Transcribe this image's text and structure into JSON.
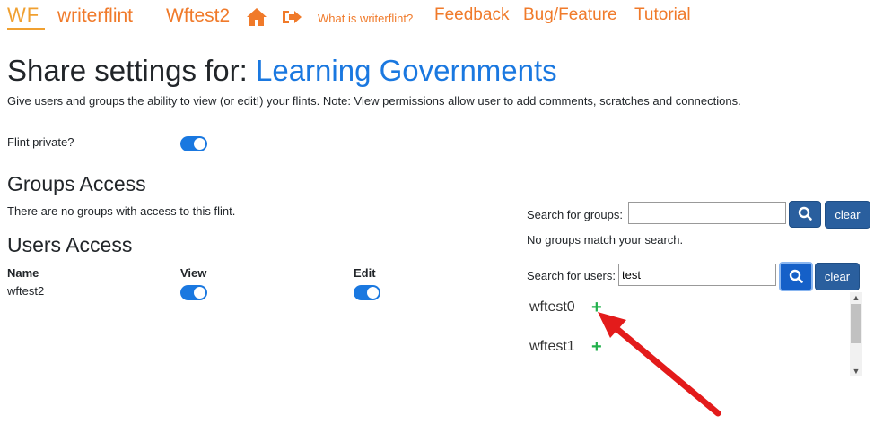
{
  "nav": {
    "logo": "WF",
    "brand": "writerflint",
    "user": "Wftest2",
    "home_icon": "home-icon",
    "logout_icon": "sign-out-icon",
    "what_is": "What is writerflint?",
    "feedback": "Feedback",
    "bug": "Bug/Feature",
    "tutorial": "Tutorial"
  },
  "page": {
    "title_prefix": "Share settings for:",
    "flint_name": "Learning Governments",
    "subtitle": "Give users and groups the ability to view (or edit!) your flints. Note: View permissions allow user to add comments, scratches and connections."
  },
  "private": {
    "label": "Flint private?",
    "on": true
  },
  "groups": {
    "heading": "Groups Access",
    "empty_text": "There are no groups with access to this flint.",
    "search_label": "Search for groups:",
    "search_value": "",
    "clear_label": "clear",
    "no_match": "No groups match your search."
  },
  "users": {
    "heading": "Users Access",
    "columns": [
      "Name",
      "View",
      "Edit"
    ],
    "rows": [
      {
        "name": "wftest2",
        "view": true,
        "edit": true
      }
    ],
    "search_label": "Search for users:",
    "search_value": "test",
    "clear_label": "clear",
    "results": [
      "wftest0",
      "wftest1"
    ]
  },
  "colors": {
    "accent_orange": "#f07a2a",
    "link_blue": "#1a78e0",
    "button_blue": "#2a5f9e",
    "add_green": "#22b14c",
    "arrow_red": "#e31b1b"
  }
}
